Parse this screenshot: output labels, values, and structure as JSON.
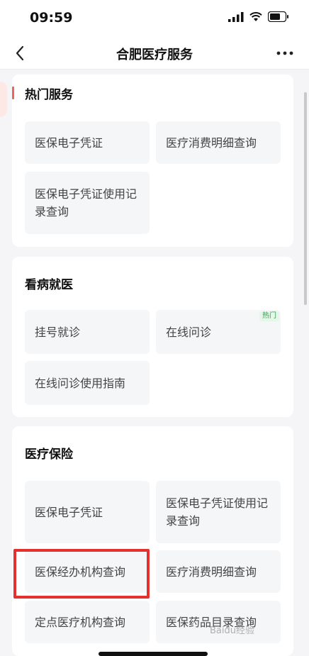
{
  "status_bar": {
    "time": "09:59"
  },
  "nav": {
    "title": "合肥医疗服务"
  },
  "sections": {
    "hot": {
      "title": "热门服务",
      "items": [
        "医保电子凭证",
        "医疗消费明细查询",
        "医保电子凭证使用记录查询"
      ]
    },
    "visit": {
      "title": "看病就医",
      "items": [
        "挂号就诊",
        "在线问诊",
        "在线问诊使用指南"
      ],
      "badge": "热门"
    },
    "insurance": {
      "title": "医疗保险",
      "items": [
        "医保电子凭证",
        "医保电子凭证使用记录查询",
        "医保经办机构查询",
        "医疗消费明细查询",
        "定点医疗机构查询",
        "医保药品目录查询"
      ]
    }
  },
  "watermark": "Baidu经验",
  "colors": {
    "accent": "#e8665c",
    "highlight": "#e4312f",
    "badge_green": "#2fa050"
  }
}
